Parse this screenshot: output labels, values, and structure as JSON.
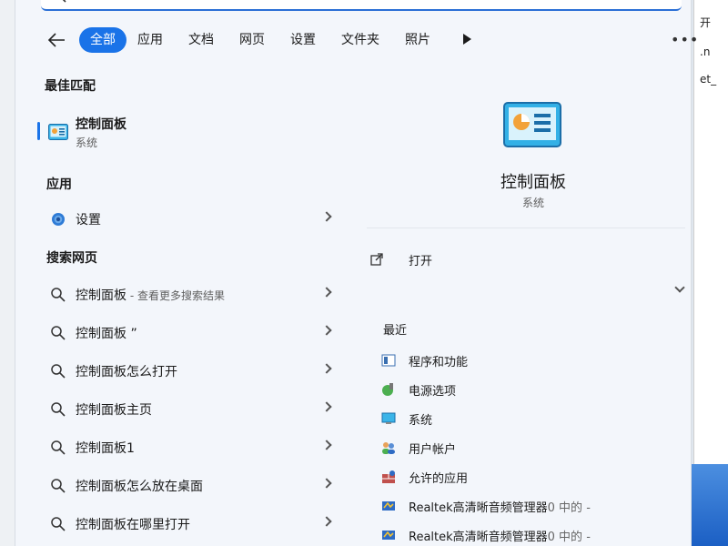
{
  "colors": {
    "accent": "#1a73e8",
    "panel_bg": "#f3f6fb"
  },
  "tabs": [
    {
      "label": "全部",
      "active": true
    },
    {
      "label": "应用"
    },
    {
      "label": "文档"
    },
    {
      "label": "网页"
    },
    {
      "label": "设置"
    },
    {
      "label": "文件夹"
    },
    {
      "label": "照片"
    }
  ],
  "sections": {
    "best_match": "最佳匹配",
    "apps": "应用",
    "web": "搜索网页"
  },
  "best_match": {
    "title": "控制面板",
    "subtitle": "系统",
    "icon": "control-panel-icon"
  },
  "apps": [
    {
      "label": "设置",
      "icon": "gear-icon"
    }
  ],
  "web_results": [
    {
      "label": "控制面板",
      "hint": " - 查看更多搜索结果"
    },
    {
      "label": "控制面板 ”",
      "hint": ""
    },
    {
      "label": "控制面板怎么打开",
      "hint": ""
    },
    {
      "label": "控制面板主页",
      "hint": ""
    },
    {
      "label": "控制面板1",
      "hint": ""
    },
    {
      "label": "控制面板怎么放在桌面",
      "hint": ""
    },
    {
      "label": "控制面板在哪里打开",
      "hint": ""
    }
  ],
  "detail": {
    "title": "控制面板",
    "subtitle": "系统",
    "open_label": "打开",
    "recent_title": "最近",
    "recent": [
      {
        "label": "程序和功能",
        "dim": "",
        "icon": "programs-icon"
      },
      {
        "label": "电源选项",
        "dim": "",
        "icon": "power-options-icon"
      },
      {
        "label": "系统",
        "dim": "",
        "icon": "system-icon"
      },
      {
        "label": "用户帐户",
        "dim": "",
        "icon": "user-accounts-icon"
      },
      {
        "label": "允许的应用",
        "dim": "",
        "icon": "firewall-icon"
      },
      {
        "label": "Realtek高清晰音频管理器",
        "dim": "0 中的 -",
        "icon": "realtek-icon"
      },
      {
        "label": "Realtek高清晰音频管理器",
        "dim": "0 中的 -",
        "icon": "realtek-icon"
      }
    ]
  },
  "desktop_fragments": {
    "right_top": "开",
    "right_mid1": ".n",
    "right_mid2": "et_"
  }
}
